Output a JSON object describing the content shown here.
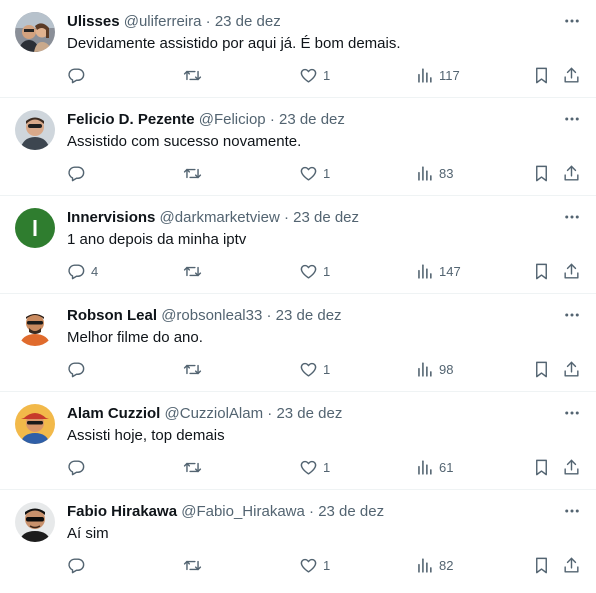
{
  "colors": {
    "text": "#0f1419",
    "secondary": "#536471",
    "divider": "#eff3f4"
  },
  "icons": {
    "more": "more-horizontal-icon",
    "reply": "reply-icon",
    "retweet": "retweet-icon",
    "like": "heart-icon",
    "views": "views-bar-chart-icon",
    "bookmark": "bookmark-icon",
    "share": "share-icon"
  },
  "separator": "·",
  "tweets": [
    {
      "name": "Ulisses",
      "handle": "@uliferreira",
      "date": "23 de dez",
      "text": "Devidamente assistido por aqui já. É bom demais.",
      "replies": "",
      "retweets": "",
      "likes": "1",
      "views": "117",
      "avatar": "photo-couple"
    },
    {
      "name": "Felicio D. Pezente",
      "handle": "@Feliciop",
      "date": "23 de dez",
      "text": "Assistido com sucesso novamente.",
      "replies": "",
      "retweets": "",
      "likes": "1",
      "views": "83",
      "avatar": "photo-man-sunglasses"
    },
    {
      "name": "Innervisions",
      "handle": "@darkmarketview",
      "date": "23 de dez",
      "text": "1 ano depois da minha iptv",
      "replies": "4",
      "retweets": "",
      "likes": "1",
      "views": "147",
      "avatar": "green-letter-I"
    },
    {
      "name": "Robson Leal",
      "handle": "@robsonleal33",
      "date": "23 de dez",
      "text": "Melhor filme do ano.",
      "replies": "",
      "retweets": "",
      "likes": "1",
      "views": "98",
      "avatar": "cartoon-man"
    },
    {
      "name": "Alam Cuzziol",
      "handle": "@CuzziolAlam",
      "date": "23 de dez",
      "text": "Assisti hoje, top demais",
      "replies": "",
      "retweets": "",
      "likes": "1",
      "views": "61",
      "avatar": "cartoon-man-cap"
    },
    {
      "name": "Fabio Hirakawa",
      "handle": "@Fabio_Hirakawa",
      "date": "23 de dez",
      "text": "Aí sim",
      "replies": "",
      "retweets": "",
      "likes": "1",
      "views": "82",
      "avatar": "photo-man-sunglasses-dark"
    }
  ]
}
